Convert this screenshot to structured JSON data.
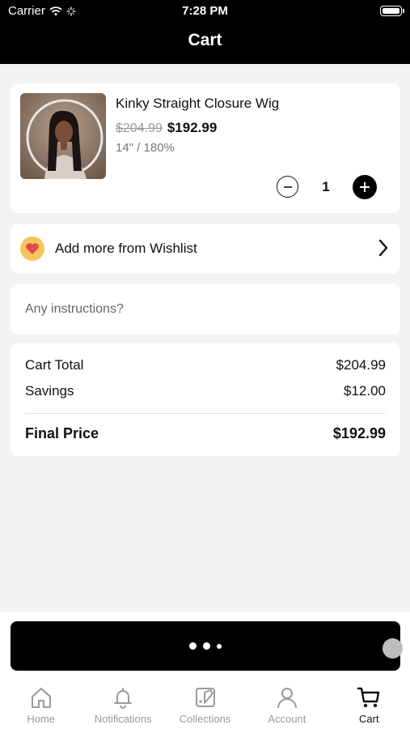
{
  "status_bar": {
    "carrier": "Carrier",
    "time": "7:28 PM"
  },
  "header": {
    "title": "Cart"
  },
  "cart_item": {
    "name": "Kinky Straight Closure Wig",
    "original_price": "$204.99",
    "price": "$192.99",
    "variant": "14\" / 180%",
    "quantity": "1"
  },
  "wishlist": {
    "label": "Add more from Wishlist"
  },
  "instructions": {
    "placeholder": "Any instructions?"
  },
  "summary": {
    "cart_total_label": "Cart Total",
    "cart_total_value": "$204.99",
    "savings_label": "Savings",
    "savings_value": "$12.00",
    "final_label": "Final Price",
    "final_value": "$192.99"
  },
  "tabs": [
    {
      "label": "Home",
      "icon": "home-icon"
    },
    {
      "label": "Notifications",
      "icon": "bell-icon"
    },
    {
      "label": "Collections",
      "icon": "collections-icon"
    },
    {
      "label": "Account",
      "icon": "account-icon"
    },
    {
      "label": "Cart",
      "icon": "cart-icon",
      "active": true
    }
  ],
  "colors": {
    "header_bg": "#000000",
    "accent": "#000000",
    "heart_badge": "#f6c65a",
    "heart": "#e5484d"
  }
}
